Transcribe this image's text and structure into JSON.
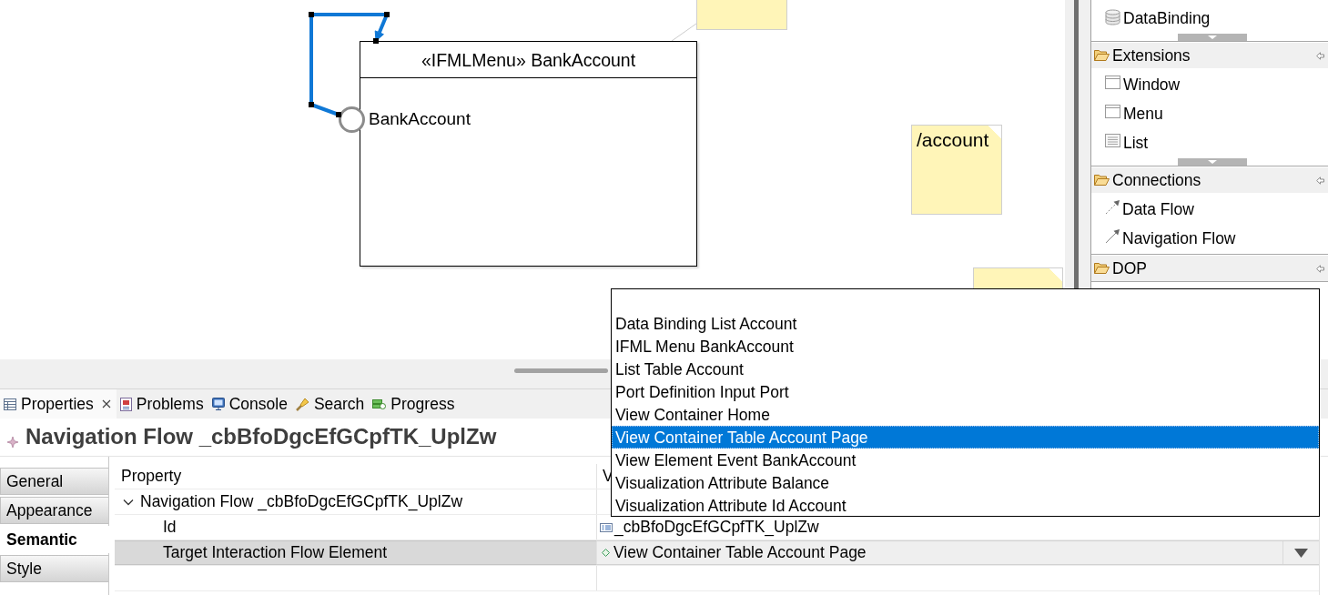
{
  "diagram": {
    "container": {
      "title": "«IFMLMenu» BankAccount",
      "event_label": "BankAccount"
    },
    "navigation_flow": {
      "selected": true
    },
    "notes": [
      {
        "text": "/account"
      }
    ]
  },
  "palette": {
    "top_items": [
      {
        "label": "DataBinding",
        "kind": "database"
      }
    ],
    "top_more_below": true,
    "drawers": [
      {
        "label": "Extensions",
        "items": [
          {
            "label": "Window",
            "kind": "panel"
          },
          {
            "label": "Menu",
            "kind": "panel"
          },
          {
            "label": "List",
            "kind": "list"
          }
        ],
        "more_below": true
      },
      {
        "label": "Connections",
        "items": [
          {
            "label": "Data Flow",
            "kind": "data_flow"
          },
          {
            "label": "Navigation Flow",
            "kind": "navigation_flow"
          }
        ],
        "more_below": false
      },
      {
        "label": "DOP",
        "more_below": false
      }
    ]
  },
  "properties_view": {
    "tabs": [
      {
        "label": "Properties",
        "kind": "properties",
        "selected": true
      },
      {
        "label": "Problems",
        "kind": "problems",
        "selected": false
      },
      {
        "label": "Console",
        "kind": "console",
        "selected": false
      },
      {
        "label": "Search",
        "kind": "search",
        "selected": false
      },
      {
        "label": "Progress",
        "kind": "progress",
        "selected": false
      }
    ],
    "title": "Navigation Flow _cbBfoDgcEfGCpfTK_UplZw",
    "section_tabs": [
      {
        "label": "General",
        "selected": false
      },
      {
        "label": "Appearance",
        "selected": false
      },
      {
        "label": "Semantic",
        "selected": true
      },
      {
        "label": "Style",
        "selected": false
      }
    ],
    "table": {
      "columns": [
        "Property",
        "V"
      ],
      "rows": [
        {
          "property": "Navigation Flow _cbBfoDgcEfGCpfTK_UplZw",
          "expanded": true,
          "children": [
            {
              "property": "Id",
              "value": "_cbBfoDgcEfGCpfTK_UplZw",
              "kind": "text",
              "selected": false
            },
            {
              "property": "Target Interaction Flow Element",
              "value": "View Container Table Account Page",
              "kind": "reference",
              "selected": true
            }
          ]
        }
      ]
    },
    "dropdown": {
      "options": [
        {
          "label": "Data Binding List Account",
          "selected": false
        },
        {
          "label": "IFML Menu BankAccount",
          "selected": false
        },
        {
          "label": "List Table Account",
          "selected": false
        },
        {
          "label": "Port Definition Input Port",
          "selected": false
        },
        {
          "label": "View Container Home",
          "selected": false
        },
        {
          "label": "View Container Table Account Page",
          "selected": true
        },
        {
          "label": "View Element Event BankAccount",
          "selected": false
        },
        {
          "label": "Visualization Attribute Balance",
          "selected": false
        },
        {
          "label": "Visualization Attribute Id Account",
          "selected": false
        }
      ]
    }
  }
}
